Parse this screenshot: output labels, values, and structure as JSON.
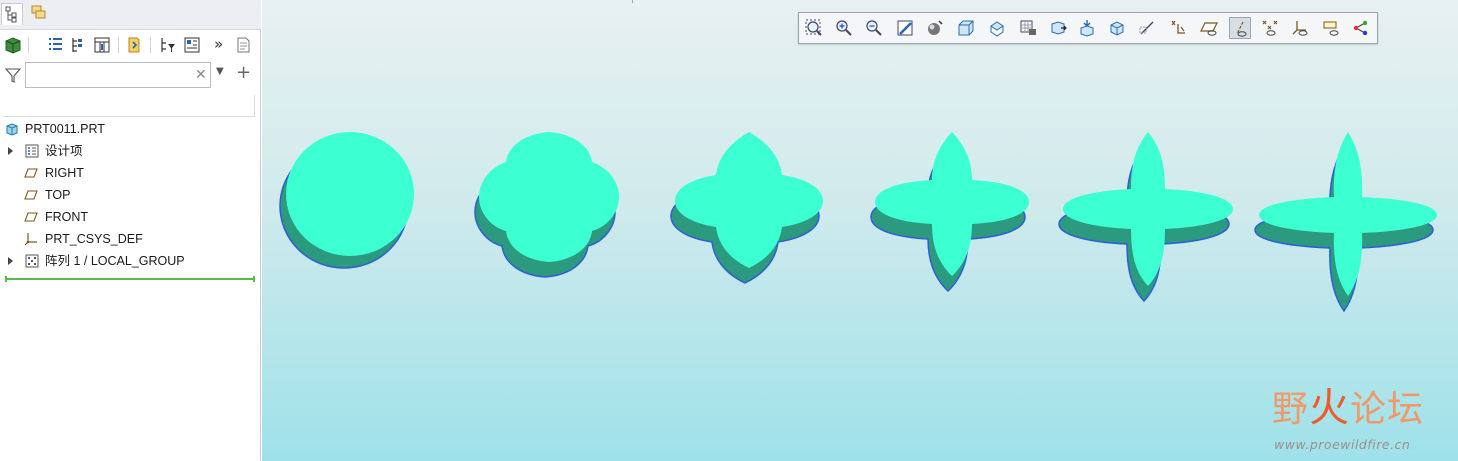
{
  "panel": {
    "search": {
      "value": "",
      "placeholder": ""
    },
    "tree": {
      "root": "PRT0011.PRT",
      "items": [
        {
          "label": "设计项",
          "icon": "design-items-icon",
          "expandable": true
        },
        {
          "label": "RIGHT",
          "icon": "datum-plane-icon",
          "expandable": false
        },
        {
          "label": "TOP",
          "icon": "datum-plane-icon",
          "expandable": false
        },
        {
          "label": "FRONT",
          "icon": "datum-plane-icon",
          "expandable": false
        },
        {
          "label": "PRT_CSYS_DEF",
          "icon": "coordinate-system-icon",
          "expandable": false
        },
        {
          "label": "阵列 1 / LOCAL_GROUP",
          "icon": "pattern-icon",
          "expandable": true
        }
      ]
    }
  },
  "view_toolbar": {
    "buttons": [
      "refit-icon",
      "zoom-in-icon",
      "zoom-out-icon",
      "repaint-icon",
      "display-style-icon",
      "saved-orientations-icon",
      "view-manager-icon",
      "perspective-icon",
      "section-icon",
      "annotation-display-icon",
      "spin-center-icon",
      "plane-tag-icon",
      "datum-display-icon",
      "plane-display-icon",
      "axis-display-icon",
      "point-display-icon",
      "csys-display-icon",
      "annotation-icon",
      "spin-center-display-icon"
    ],
    "pressed": "axis-display-icon"
  },
  "colors": {
    "part_top": "#3cffd2",
    "part_side": "#2b9a7e",
    "part_edge": "#2e5fd6",
    "bg_top": "#e8f1f1",
    "bg_bottom": "#9ee1ea"
  },
  "watermark": {
    "chars": [
      "野",
      "火",
      "论坛"
    ],
    "url": "www.proewildfire.cn"
  }
}
